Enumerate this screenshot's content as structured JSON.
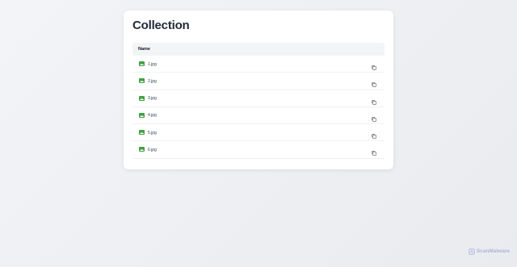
{
  "collection": {
    "title": "Collection",
    "column_header": "Name",
    "files": [
      {
        "name": "1​.jpg",
        "icon": "image-icon"
      },
      {
        "name": "2​.jpg",
        "icon": "image-icon"
      },
      {
        "name": "3​.jpg",
        "icon": "image-icon"
      },
      {
        "name": "4​.jpg",
        "icon": "image-icon"
      },
      {
        "name": "5​.jpg",
        "icon": "image-icon"
      },
      {
        "name": "6​.jpg",
        "icon": "image-icon"
      }
    ]
  },
  "watermark": {
    "text": "ScanMalware"
  },
  "colors": {
    "image_icon": "#43a047",
    "title": "#1f2937",
    "header_bg": "#f3f4f6",
    "watermark": "#aab6d6"
  }
}
